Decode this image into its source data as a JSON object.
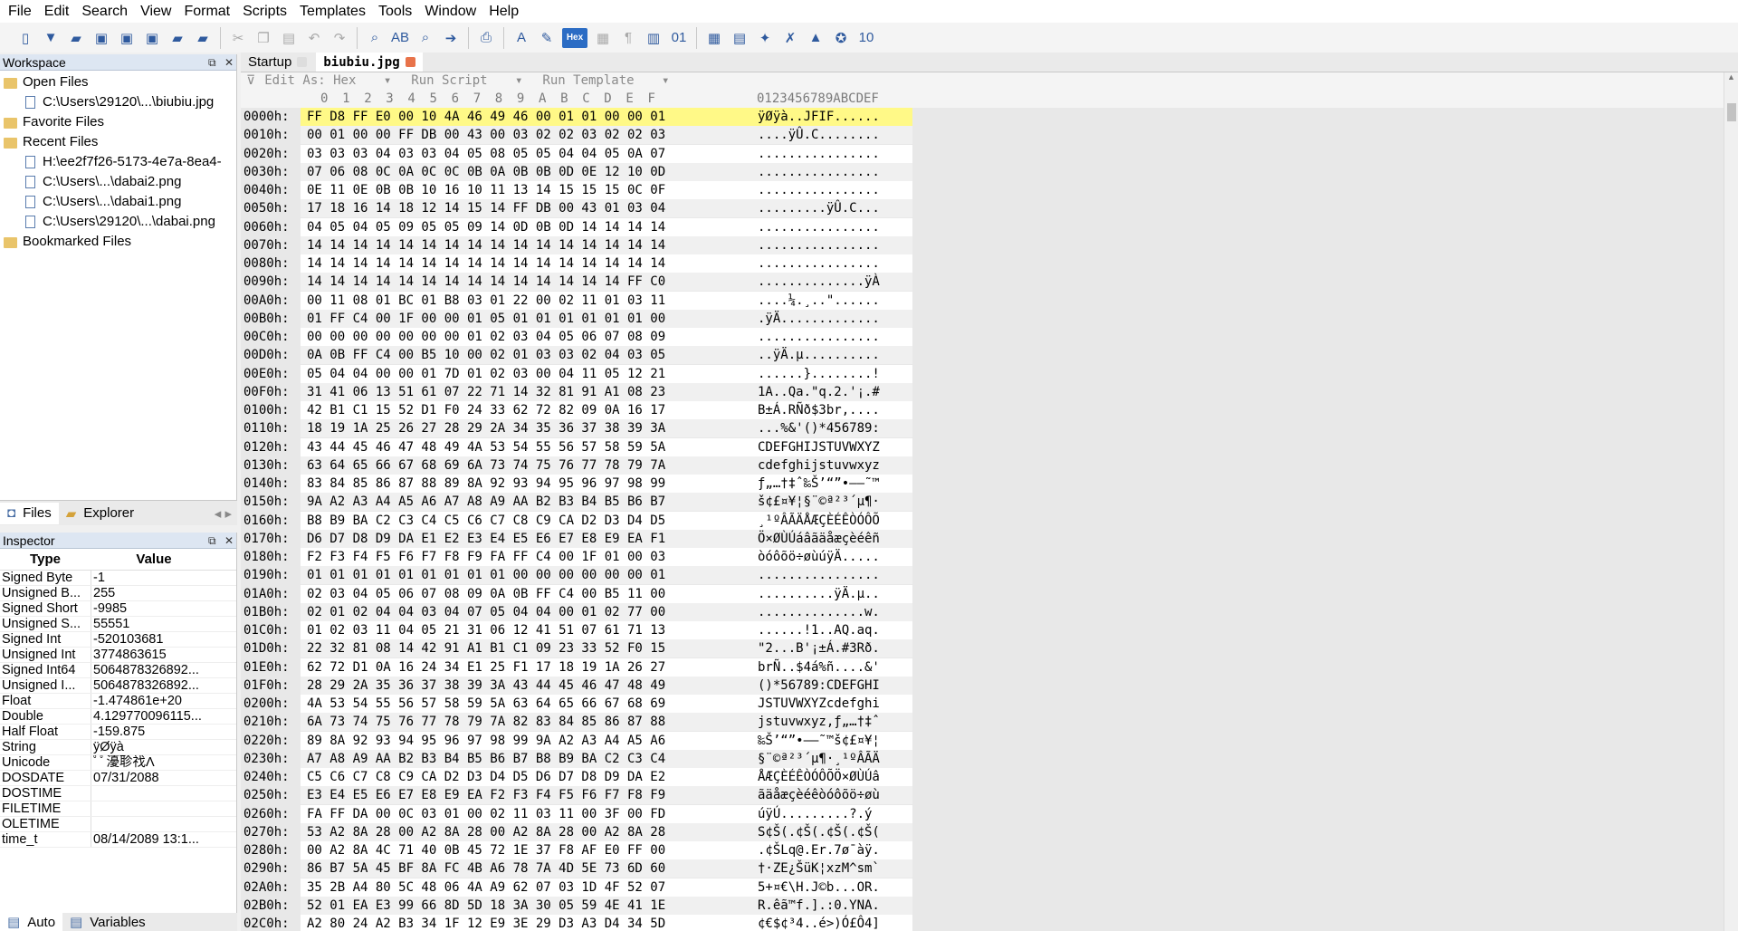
{
  "menu": [
    "File",
    "Edit",
    "Search",
    "View",
    "Format",
    "Scripts",
    "Templates",
    "Tools",
    "Window",
    "Help"
  ],
  "workspace": {
    "title": "Workspace",
    "tree": [
      {
        "level": 0,
        "type": "folder",
        "label": "Open Files"
      },
      {
        "level": 1,
        "type": "file",
        "label": "C:\\Users\\29120\\...\\biubiu.jpg"
      },
      {
        "level": 0,
        "type": "folder",
        "label": "Favorite Files"
      },
      {
        "level": 0,
        "type": "folder",
        "label": "Recent Files"
      },
      {
        "level": 1,
        "type": "file",
        "label": "H:\\ee2f7f26-5173-4e7a-8ea4-"
      },
      {
        "level": 1,
        "type": "file",
        "label": "C:\\Users\\...\\dabai2.png"
      },
      {
        "level": 1,
        "type": "file",
        "label": "C:\\Users\\...\\dabai1.png"
      },
      {
        "level": 1,
        "type": "file",
        "label": "C:\\Users\\29120\\...\\dabai.png"
      },
      {
        "level": 0,
        "type": "folder",
        "label": "Bookmarked Files"
      }
    ],
    "tabs": [
      "Files",
      "Explorer"
    ]
  },
  "inspector": {
    "title": "Inspector",
    "col_type": "Type",
    "col_value": "Value",
    "rows": [
      [
        "Signed Byte",
        "-1"
      ],
      [
        "Unsigned B...",
        "255"
      ],
      [
        "Signed Short",
        "-9985"
      ],
      [
        "Unsigned S...",
        "55551"
      ],
      [
        "Signed Int",
        "-520103681"
      ],
      [
        "Unsigned Int",
        "3774863615"
      ],
      [
        "Signed Int64",
        "5064878326892..."
      ],
      [
        "Unsigned I...",
        "5064878326892..."
      ],
      [
        "Float",
        "-1.474861e+20"
      ],
      [
        "Double",
        "4.129770096115..."
      ],
      [
        "Half Float",
        "-159.875"
      ],
      [
        "String",
        "ÿØÿà"
      ],
      [
        "Unicode",
        "ﾟﾟ瀀聄䄀Ʌ"
      ],
      [
        "DOSDATE",
        "07/31/2088"
      ],
      [
        "DOSTIME",
        ""
      ],
      [
        "FILETIME",
        ""
      ],
      [
        "OLETIME",
        ""
      ],
      [
        "time_t",
        "08/14/2089 13:1..."
      ]
    ],
    "tabs": [
      "Auto",
      "Variables"
    ]
  },
  "editor": {
    "tabs": [
      "Startup",
      "biubiu.jpg"
    ],
    "toolbar": [
      "Edit As: Hex",
      "Run Script",
      "Run Template"
    ],
    "col_headers": [
      "0",
      "1",
      "2",
      "3",
      "4",
      "5",
      "6",
      "7",
      "8",
      "9",
      "A",
      "B",
      "C",
      "D",
      "E",
      "F"
    ],
    "ascii_header": "0123456789ABCDEF",
    "rows": [
      [
        "0000h:",
        "FF D8 FF E0 00 10 4A 46 49 46 00 01 01 00 00 01",
        "ÿØÿà..JFIF......"
      ],
      [
        "0010h:",
        "00 01 00 00 FF DB 00 43 00 03 02 02 03 02 02 03",
        "....ÿÛ.C........"
      ],
      [
        "0020h:",
        "03 03 03 04 03 03 04 05 08 05 05 04 04 05 0A 07",
        "................"
      ],
      [
        "0030h:",
        "07 06 08 0C 0A 0C 0C 0B 0A 0B 0B 0D 0E 12 10 0D",
        "................"
      ],
      [
        "0040h:",
        "0E 11 0E 0B 0B 10 16 10 11 13 14 15 15 15 0C 0F",
        "................"
      ],
      [
        "0050h:",
        "17 18 16 14 18 12 14 15 14 FF DB 00 43 01 03 04",
        ".........ÿÛ.C..."
      ],
      [
        "0060h:",
        "04 05 04 05 09 05 05 09 14 0D 0B 0D 14 14 14 14",
        "................"
      ],
      [
        "0070h:",
        "14 14 14 14 14 14 14 14 14 14 14 14 14 14 14 14",
        "................"
      ],
      [
        "0080h:",
        "14 14 14 14 14 14 14 14 14 14 14 14 14 14 14 14",
        "................"
      ],
      [
        "0090h:",
        "14 14 14 14 14 14 14 14 14 14 14 14 14 14 FF C0",
        "..............ÿÀ"
      ],
      [
        "00A0h:",
        "00 11 08 01 BC 01 B8 03 01 22 00 02 11 01 03 11",
        "....¼.¸..\"......"
      ],
      [
        "00B0h:",
        "01 FF C4 00 1F 00 00 01 05 01 01 01 01 01 01 00",
        ".ÿÄ............."
      ],
      [
        "00C0h:",
        "00 00 00 00 00 00 00 01 02 03 04 05 06 07 08 09",
        "................"
      ],
      [
        "00D0h:",
        "0A 0B FF C4 00 B5 10 00 02 01 03 03 02 04 03 05",
        "..ÿÄ.µ.........."
      ],
      [
        "00E0h:",
        "05 04 04 00 00 01 7D 01 02 03 00 04 11 05 12 21",
        "......}........!"
      ],
      [
        "00F0h:",
        "31 41 06 13 51 61 07 22 71 14 32 81 91 A1 08 23",
        "1A..Qa.\"q.2.'¡.#"
      ],
      [
        "0100h:",
        "42 B1 C1 15 52 D1 F0 24 33 62 72 82 09 0A 16 17",
        "B±Á.RÑð$3br,...."
      ],
      [
        "0110h:",
        "18 19 1A 25 26 27 28 29 2A 34 35 36 37 38 39 3A",
        "...%&'()*456789:"
      ],
      [
        "0120h:",
        "43 44 45 46 47 48 49 4A 53 54 55 56 57 58 59 5A",
        "CDEFGHIJSTUVWXYZ"
      ],
      [
        "0130h:",
        "63 64 65 66 67 68 69 6A 73 74 75 76 77 78 79 7A",
        "cdefghijstuvwxyz"
      ],
      [
        "0140h:",
        "83 84 85 86 87 88 89 8A 92 93 94 95 96 97 98 99",
        "ƒ„…†‡ˆ‰Š’“”•–—˜™"
      ],
      [
        "0150h:",
        "9A A2 A3 A4 A5 A6 A7 A8 A9 AA B2 B3 B4 B5 B6 B7",
        "š¢£¤¥¦§¨©ª²³´µ¶·"
      ],
      [
        "0160h:",
        "B8 B9 BA C2 C3 C4 C5 C6 C7 C8 C9 CA D2 D3 D4 D5",
        "¸¹ºÂÃÄÅÆÇÈÉÊÒÓÔÕ"
      ],
      [
        "0170h:",
        "D6 D7 D8 D9 DA E1 E2 E3 E4 E5 E6 E7 E8 E9 EA F1",
        "Ö×ØÙÚáâãäåæçèéêñ"
      ],
      [
        "0180h:",
        "F2 F3 F4 F5 F6 F7 F8 F9 FA FF C4 00 1F 01 00 03",
        "òóôõö÷øùúÿÄ....."
      ],
      [
        "0190h:",
        "01 01 01 01 01 01 01 01 01 00 00 00 00 00 00 01",
        "................"
      ],
      [
        "01A0h:",
        "02 03 04 05 06 07 08 09 0A 0B FF C4 00 B5 11 00",
        "..........ÿÄ.µ.."
      ],
      [
        "01B0h:",
        "02 01 02 04 04 03 04 07 05 04 04 00 01 02 77 00",
        "..............w."
      ],
      [
        "01C0h:",
        "01 02 03 11 04 05 21 31 06 12 41 51 07 61 71 13",
        "......!1..AQ.aq."
      ],
      [
        "01D0h:",
        "22 32 81 08 14 42 91 A1 B1 C1 09 23 33 52 F0 15",
        "\"2...B'¡±Á.#3Rð."
      ],
      [
        "01E0h:",
        "62 72 D1 0A 16 24 34 E1 25 F1 17 18 19 1A 26 27",
        "brÑ..$4á%ñ....&'"
      ],
      [
        "01F0h:",
        "28 29 2A 35 36 37 38 39 3A 43 44 45 46 47 48 49",
        "()*56789:CDEFGHI"
      ],
      [
        "0200h:",
        "4A 53 54 55 56 57 58 59 5A 63 64 65 66 67 68 69",
        "JSTUVWXYZcdefghi"
      ],
      [
        "0210h:",
        "6A 73 74 75 76 77 78 79 7A 82 83 84 85 86 87 88",
        "jstuvwxyz‚ƒ„…†‡ˆ"
      ],
      [
        "0220h:",
        "89 8A 92 93 94 95 96 97 98 99 9A A2 A3 A4 A5 A6",
        "‰Š’“”•–—˜™š¢£¤¥¦"
      ],
      [
        "0230h:",
        "A7 A8 A9 AA B2 B3 B4 B5 B6 B7 B8 B9 BA C2 C3 C4",
        "§¨©ª²³´µ¶·¸¹ºÂÃÄ"
      ],
      [
        "0240h:",
        "C5 C6 C7 C8 C9 CA D2 D3 D4 D5 D6 D7 D8 D9 DA E2",
        "ÅÆÇÈÉÊÒÓÔÕÖ×ØÙÚâ"
      ],
      [
        "0250h:",
        "E3 E4 E5 E6 E7 E8 E9 EA F2 F3 F4 F5 F6 F7 F8 F9",
        "ãäåæçèéêòóôõö÷øù"
      ],
      [
        "0260h:",
        "FA FF DA 00 0C 03 01 00 02 11 03 11 00 3F 00 FD",
        "úÿÚ.........?.ý"
      ],
      [
        "0270h:",
        "53 A2 8A 28 00 A2 8A 28 00 A2 8A 28 00 A2 8A 28",
        "S¢Š(.¢Š(.¢Š(.¢Š("
      ],
      [
        "0280h:",
        "00 A2 8A 4C 71 40 0B 45 72 1E 37 F8 AF E0 FF 00",
        ".¢ŠLq@.Er.7ø¯àÿ."
      ],
      [
        "0290h:",
        "86 B7 5A 45 BF 8A FC 4B A6 78 7A 4D 5E 73 6D 60",
        "†·ZE¿ŠüK¦xzM^sm`"
      ],
      [
        "02A0h:",
        "35 2B A4 80 5C 48 06 4A A9 62 07 03 1D 4F 52 07",
        "5+¤€\\H.J©b...OR."
      ],
      [
        "02B0h:",
        "52 01 EA E3 99 66 8D 5D 18 3A 30 05 59 4E 41 1E",
        "R.êã™f.].:0.YNA."
      ],
      [
        "02C0h:",
        "A2 80 24 A2 B3 34 1F 12 E9 3E 29 D3 A3 D4 34 5D",
        "¢€$¢³4..é>)Ó£Ô4]"
      ]
    ]
  }
}
